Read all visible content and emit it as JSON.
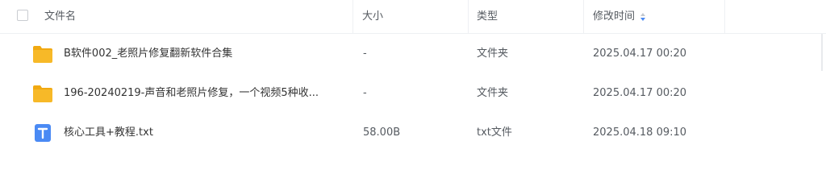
{
  "header": {
    "name": "文件名",
    "size": "大小",
    "type": "类型",
    "modified": "修改时间"
  },
  "colors": {
    "folder": "#f7b928",
    "folder_back": "#f1a911",
    "txt_icon": "#4a8af4",
    "sort_active": "#4a8af4"
  },
  "files": [
    {
      "icon": "folder-icon",
      "name": "B软件002_老照片修复翻新软件合集",
      "size": "-",
      "type": "文件夹",
      "modified": "2025.04.17 00:20"
    },
    {
      "icon": "folder-icon",
      "name": "196-20240219-声音和老照片修复，一个视频5种收...",
      "size": "-",
      "type": "文件夹",
      "modified": "2025.04.17 00:20"
    },
    {
      "icon": "txt-file-icon",
      "name": "核心工具+教程.txt",
      "size": "58.00B",
      "type": "txt文件",
      "modified": "2025.04.18 09:10"
    }
  ]
}
